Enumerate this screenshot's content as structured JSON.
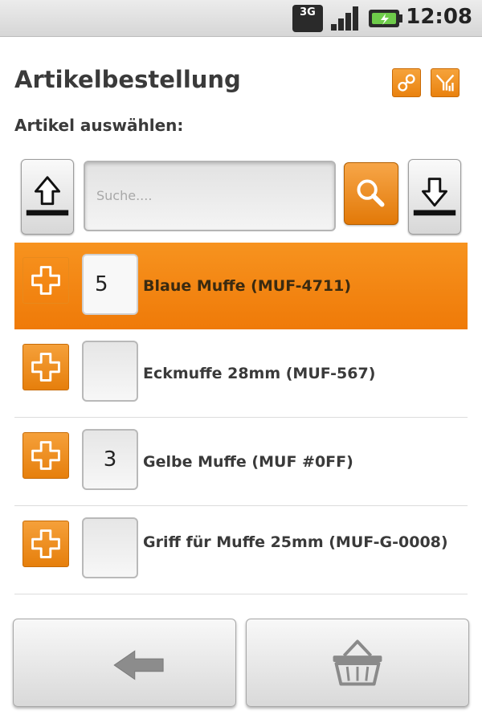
{
  "status_bar": {
    "network": "3G",
    "time": "12:08"
  },
  "header": {
    "title": "Artikelbestellung",
    "link_icon": "link-icon",
    "filter_icon": "filter-icon"
  },
  "subtitle": "Artikel auswählen:",
  "search": {
    "placeholder": "Suche....",
    "up_icon": "arrow-up-icon",
    "search_icon": "magnifier-icon",
    "down_icon": "arrow-down-icon"
  },
  "items": [
    {
      "qty": "5",
      "label": "Blaue Muffe (MUF-4711)",
      "selected": true
    },
    {
      "qty": "",
      "label": "Eckmuffe 28mm (MUF-567)",
      "selected": false
    },
    {
      "qty": "3",
      "label": "Gelbe Muffe (MUF #0FF)",
      "selected": false
    },
    {
      "qty": "",
      "label": "Griff für Muffe 25mm (MUF-G-0008)",
      "selected": false
    }
  ],
  "bottom": {
    "back_icon": "arrow-left-icon",
    "cart_icon": "basket-icon"
  },
  "colors": {
    "accent": "#ef7f0c",
    "background": "#ffffff"
  }
}
